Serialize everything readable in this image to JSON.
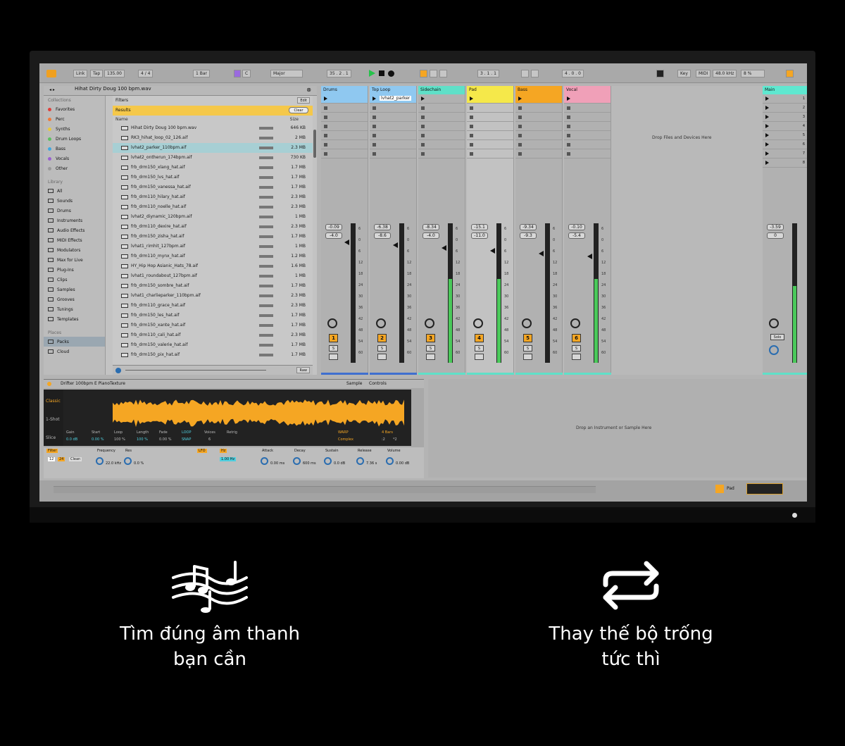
{
  "transport": {
    "link": "Link",
    "tap": "Tap",
    "tempo": "135.00",
    "signature": "4 / 4",
    "bar_length": "1 Bar",
    "key": "C",
    "scale": "Major",
    "position": "35 .  2 .  1",
    "loop_start": "3 .  1 .  1",
    "loop_length": "4 .  0 .  0",
    "key_label": "Key",
    "midi_label": "MIDI",
    "sample_rate": "48.0 kHz",
    "cpu": "8 %"
  },
  "browser": {
    "path": "Hihat Dirty Doug 100 bpm.wav",
    "collections_header": "Collections",
    "collections": [
      {
        "label": "Favorites",
        "color": "#e0403a"
      },
      {
        "label": "Perc",
        "color": "#f07a3a"
      },
      {
        "label": "Synths",
        "color": "#e8c840"
      },
      {
        "label": "Drum Loops",
        "color": "#5cc060"
      },
      {
        "label": "Bass",
        "color": "#40a8e0"
      },
      {
        "label": "Vocals",
        "color": "#9a60d0"
      },
      {
        "label": "Other",
        "color": "#9a9a9a"
      }
    ],
    "library_header": "Library",
    "library": [
      "All",
      "Sounds",
      "Drums",
      "Instruments",
      "Audio Effects",
      "MIDI Effects",
      "Modulators",
      "Max for Live",
      "Plug-Ins",
      "Clips",
      "Samples",
      "Grooves",
      "Tunings",
      "Templates"
    ],
    "places_header": "Places",
    "places": [
      "Packs",
      "Cloud"
    ],
    "filters_label": "Filters",
    "edit_label": "Edit",
    "results_label": "Results",
    "clear_label": "Clear",
    "col_name": "Name",
    "col_size": "Size",
    "raw_label": "Raw",
    "files": [
      {
        "name": "Hihat Dirty Doug 100 bpm.wav",
        "size": "646 KB"
      },
      {
        "name": "RK3_hihat_loop_02_126.aif",
        "size": "2 MB"
      },
      {
        "name": "lvhat2_parker_110bpm.aif",
        "size": "2.3 MB"
      },
      {
        "name": "lvhat2_ontherun_174bpm.aif",
        "size": "730 KB"
      },
      {
        "name": "frb_drm150_xlang_hat.aif",
        "size": "1.7 MB"
      },
      {
        "name": "frb_drm150_lvs_hat.aif",
        "size": "1.7 MB"
      },
      {
        "name": "frb_drm150_vanessa_hat.aif",
        "size": "1.7 MB"
      },
      {
        "name": "frb_drm110_hilary_hat.aif",
        "size": "2.3 MB"
      },
      {
        "name": "frb_drm110_noelle_hat.aif",
        "size": "2.3 MB"
      },
      {
        "name": "lvhat2_diynamic_120bpm.aif",
        "size": "1 MB"
      },
      {
        "name": "frb_drm110_dexire_hat.aif",
        "size": "2.3 MB"
      },
      {
        "name": "frb_drm150_zisha_hat.aif",
        "size": "1.7 MB"
      },
      {
        "name": "lvhat1_rimhit_127bpm.aif",
        "size": "1 MB"
      },
      {
        "name": "frb_drm110_mynx_hat.aif",
        "size": "1.2 MB"
      },
      {
        "name": "HY_Hip Hop Asianic_Hats_78.aif",
        "size": "1.6 MB"
      },
      {
        "name": "lvhat1_roundabout_127bpm.aif",
        "size": "1 MB"
      },
      {
        "name": "frb_drm150_sombre_hat.aif",
        "size": "1.7 MB"
      },
      {
        "name": "lvhat1_charlieparker_110bpm.aif",
        "size": "2.3 MB"
      },
      {
        "name": "frb_drm110_grace_hat.aif",
        "size": "2.3 MB"
      },
      {
        "name": "frb_drm150_les_hat.aif",
        "size": "1.7 MB"
      },
      {
        "name": "frb_drm150_xante_hat.aif",
        "size": "1.7 MB"
      },
      {
        "name": "frb_drm110_cali_hat.aif",
        "size": "2.3 MB"
      },
      {
        "name": "frb_drm150_valerie_hat.aif",
        "size": "1.7 MB"
      },
      {
        "name": "frb_drm150_pix_hat.aif",
        "size": "1.7 MB"
      }
    ]
  },
  "session": {
    "drop_files": "Drop Files and Devices Here",
    "tracks": [
      {
        "name": "Drums",
        "color": "#8fc8f0",
        "clip": "",
        "vol": "-0.09",
        "pan": "-4.0",
        "num": "1",
        "level": 0
      },
      {
        "name": "Top Loop",
        "color": "#8fc8f0",
        "clip": "lvhat2_parker",
        "vol": "-6.38",
        "pan": "-8.6",
        "num": "2",
        "level": 0
      },
      {
        "name": "Sidechain",
        "color": "#5fe0c8",
        "clip": "",
        "vol": "-8.34",
        "pan": "-4.0",
        "num": "3",
        "level": 0.6
      },
      {
        "name": "Pad",
        "color": "#f5e84a",
        "clip": "",
        "vol": "-15.1",
        "pan": "-11.0",
        "num": "4",
        "level": 0.6
      },
      {
        "name": "Bass",
        "color": "#f5a623",
        "clip": "",
        "vol": "-9.34",
        "pan": "-9.3",
        "num": "5",
        "level": 0
      },
      {
        "name": "Vocal",
        "color": "#f0a0b8",
        "clip": "",
        "vol": "-0.10",
        "pan": "-5.4",
        "num": "6",
        "level": 0.6
      }
    ],
    "main": {
      "name": "Main",
      "color": "#5fe8d0",
      "vol": "-3.59",
      "pan": "0",
      "solo": "Solo",
      "level": 0.55,
      "scenes": [
        "1",
        "2",
        "3",
        "4",
        "5",
        "6",
        "7",
        "8"
      ]
    },
    "meter_scale": [
      "6",
      "0",
      "6",
      "12",
      "18",
      "24",
      "30",
      "36",
      "42",
      "48",
      "54",
      "60"
    ]
  },
  "device": {
    "title": "Drifter 100bpm E PianoTexture",
    "tab_sample": "Sample",
    "tab_controls": "Controls",
    "mode": "Classic",
    "mode2": "1-Shot",
    "mode3": "Slice",
    "gain_label": "Gain",
    "gain": "0.0 dB",
    "start_label": "Start",
    "start": "0.00 %",
    "loop_label": "Loop",
    "loop": "100 %",
    "length_label": "Length",
    "length": "100 %",
    "fade_label": "Fade",
    "fade": "0.00 %",
    "loop_btn": "LOOP",
    "snap_btn": "SNAP",
    "voices_label": "Voices",
    "voices": "6",
    "retrig_label": "Retrig",
    "warp_btn": "WARP",
    "bars": "4 Bars",
    "complex": "Complex",
    "half": ":2",
    "double": "*2",
    "filter_label": "Filter",
    "filter_type": "Clean",
    "freq_label": "Frequency",
    "freq": "22.0 kHz",
    "res_label": "Res",
    "res": "0.0 %",
    "lfo_label": "LFO",
    "lfo_hz": "Hz",
    "lfo_rate": "1.00 Hz",
    "attack_label": "Attack",
    "attack": "0.00 ms",
    "decay_label": "Decay",
    "decay": "600 ms",
    "sustain_label": "Sustain",
    "sustain": "0.0 dB",
    "release_label": "Release",
    "release": "7.36 s",
    "volume_label": "Volume",
    "volume": "0.00 dB",
    "filter_num_a": "12",
    "filter_num_b": "24"
  },
  "instrument_drop": "Drop an Instrument or Sample Here",
  "status": {
    "track": "Pad"
  },
  "features": [
    {
      "icon": "music-notes-icon",
      "line1": "Tìm đúng âm thanh",
      "line2": "bạn cần"
    },
    {
      "icon": "swap-arrows-icon",
      "line1": "Thay thế bộ trống",
      "line2": "tức thì"
    }
  ]
}
